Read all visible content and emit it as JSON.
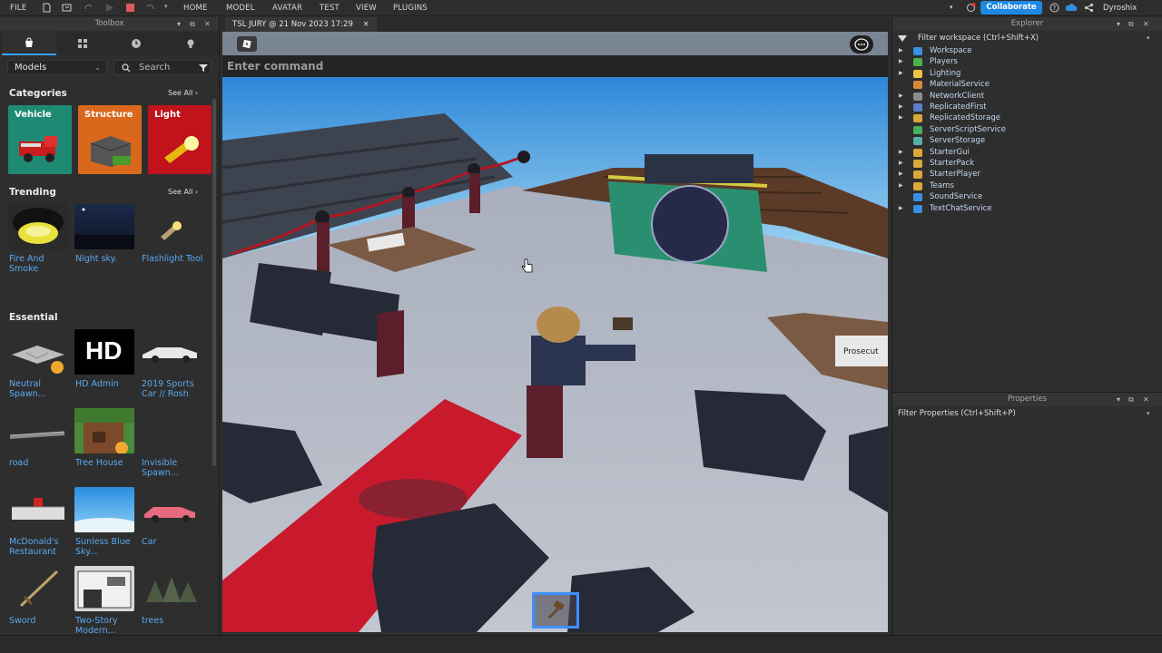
{
  "menubar": {
    "file": "FILE",
    "tabs": [
      "HOME",
      "MODEL",
      "AVATAR",
      "TEST",
      "VIEW",
      "PLUGINS"
    ],
    "collaborate": "Collaborate",
    "username": "Dyroshix"
  },
  "toolbox": {
    "title": "Toolbox",
    "category_select": "Models",
    "search_placeholder": "Search",
    "categories_heading": "Categories",
    "see_all": "See All",
    "categories": [
      {
        "label": "Vehicle",
        "color": "#1f8a74"
      },
      {
        "label": "Structure",
        "color": "#d9681c"
      },
      {
        "label": "Light",
        "color": "#c0131b"
      }
    ],
    "trending_heading": "Trending",
    "trending": [
      "Fire And Smoke",
      "Night sky.",
      "Flashlight Tool"
    ],
    "essential_heading": "Essential",
    "essential": [
      "Neutral Spawn...",
      "HD Admin",
      "2019 Sports Car // Rosh",
      "road",
      "Tree House",
      "Invisible Spawn...",
      "McDonald's Restaurant",
      "Sunless Blue Sky...",
      "Car",
      "Sword",
      "Two-Story Modern...",
      "trees"
    ],
    "hd_admin_logo": "HD"
  },
  "document": {
    "tab_title": "TSL JURY @ 21 Nov 2023 17:29",
    "close": "×",
    "command_placeholder": "Enter command",
    "table_sign": "Prosecut"
  },
  "explorer": {
    "title": "Explorer",
    "filter": "Filter workspace (Ctrl+Shift+X)",
    "items": [
      {
        "label": "Workspace",
        "expandable": true,
        "color": "#3a8fe0"
      },
      {
        "label": "Players",
        "expandable": true,
        "color": "#4bb24b"
      },
      {
        "label": "Lighting",
        "expandable": true,
        "color": "#e9c440"
      },
      {
        "label": "MaterialService",
        "expandable": false,
        "color": "#d9883a"
      },
      {
        "label": "NetworkClient",
        "expandable": true,
        "color": "#8c8c8c"
      },
      {
        "label": "ReplicatedFirst",
        "expandable": true,
        "color": "#5a7fd0"
      },
      {
        "label": "ReplicatedStorage",
        "expandable": true,
        "color": "#d9a83a"
      },
      {
        "label": "ServerScriptService",
        "expandable": false,
        "color": "#48b05f"
      },
      {
        "label": "ServerStorage",
        "expandable": false,
        "color": "#5ab0a8"
      },
      {
        "label": "StarterGui",
        "expandable": true,
        "color": "#d9a83a"
      },
      {
        "label": "StarterPack",
        "expandable": true,
        "color": "#d9a83a"
      },
      {
        "label": "StarterPlayer",
        "expandable": true,
        "color": "#d9a83a"
      },
      {
        "label": "Teams",
        "expandable": true,
        "color": "#d9a83a"
      },
      {
        "label": "SoundService",
        "expandable": false,
        "color": "#3a8fe0"
      },
      {
        "label": "TextChatService",
        "expandable": true,
        "color": "#3a8fe0"
      }
    ]
  },
  "properties": {
    "title": "Properties",
    "filter": "Filter Properties (Ctrl+Shift+P)"
  }
}
